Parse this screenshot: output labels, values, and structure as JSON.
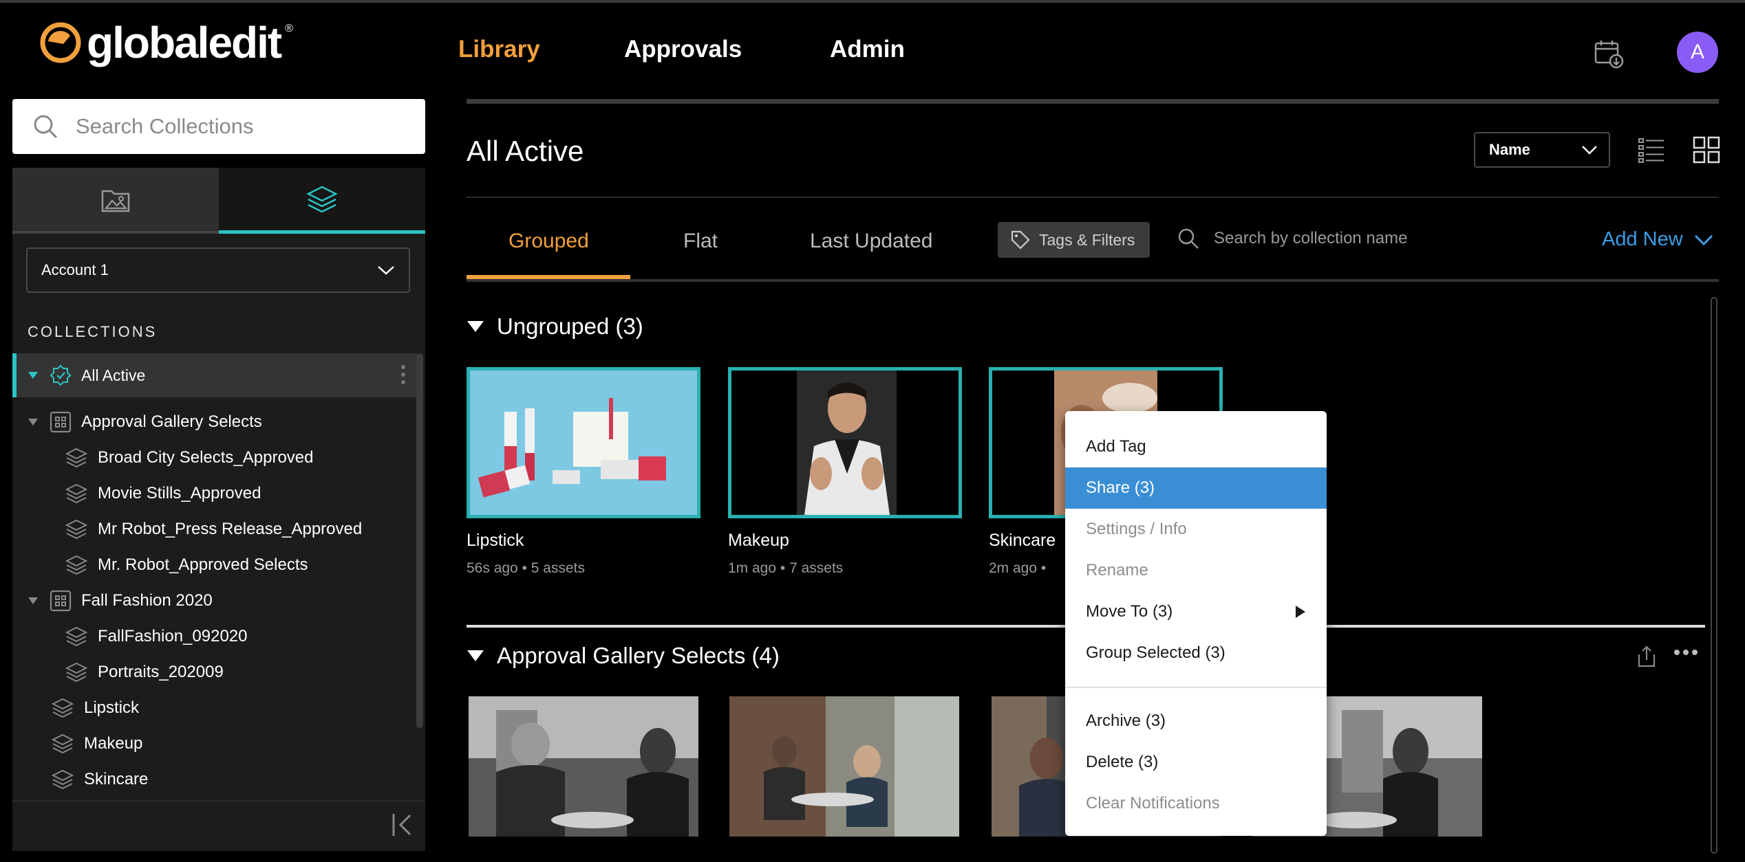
{
  "app": {
    "logo_text": "globaledit",
    "logo_mark": "®"
  },
  "nav": {
    "library": "Library",
    "approvals": "Approvals",
    "admin": "Admin",
    "avatar_initial": "A",
    "active_color": "#f2a03d"
  },
  "sidebar": {
    "search_placeholder": "Search Collections",
    "account": "Account 1",
    "collections_heading": "COLLECTIONS",
    "all_active": "All Active",
    "accent_color": "#2cc4c4",
    "tree": [
      {
        "label": "Approval Gallery Selects",
        "type": "group",
        "expanded": true
      },
      {
        "label": "Broad City Selects_Approved",
        "type": "collection"
      },
      {
        "label": "Movie Stills_Approved",
        "type": "collection"
      },
      {
        "label": "Mr Robot_Press Release_Approved",
        "type": "collection"
      },
      {
        "label": "Mr. Robot_Approved Selects",
        "type": "collection"
      },
      {
        "label": "Fall Fashion 2020",
        "type": "group",
        "expanded": true
      },
      {
        "label": "FallFashion_092020",
        "type": "collection"
      },
      {
        "label": "Portraits_202009",
        "type": "collection"
      },
      {
        "label": "Lipstick",
        "type": "collection"
      },
      {
        "label": "Makeup",
        "type": "collection"
      },
      {
        "label": "Skincare",
        "type": "collection"
      }
    ]
  },
  "main": {
    "title": "All Active",
    "sort_label": "Name",
    "tabs": {
      "grouped": "Grouped",
      "flat": "Flat",
      "last_updated": "Last Updated"
    },
    "tags_filters": "Tags & Filters",
    "search_placeholder": "Search by collection name",
    "add_new": "Add New",
    "link_color": "#3b9ee8",
    "groups": {
      "ungrouped": "Ungrouped (3)",
      "approval": "Approval Gallery Selects (4)"
    },
    "cards": [
      {
        "title": "Lipstick",
        "time": "56s ago",
        "assets": "5 assets"
      },
      {
        "title": "Makeup",
        "time": "1m ago",
        "assets": "7 assets"
      },
      {
        "title": "Skincare",
        "time": "2m ago",
        "assets": ""
      }
    ],
    "selection_color": "#2ab0b0"
  },
  "context_menu": {
    "items": [
      {
        "label": "Add Tag",
        "state": "normal"
      },
      {
        "label": "Share (3)",
        "state": "active"
      },
      {
        "label": "Settings / Info",
        "state": "disabled"
      },
      {
        "label": "Rename",
        "state": "disabled"
      },
      {
        "label": "Move To (3)",
        "state": "normal",
        "submenu": true
      },
      {
        "label": "Group Selected (3)",
        "state": "normal"
      },
      {
        "label": "Archive (3)",
        "state": "normal"
      },
      {
        "label": "Delete (3)",
        "state": "normal"
      },
      {
        "label": "Clear Notifications",
        "state": "disabled"
      }
    ],
    "highlight_color": "#3a8fd4"
  },
  "icons": {
    "logo": "globaledit-logo-icon",
    "download": "download-calendar-icon",
    "search": "search-icon",
    "gallery_tab": "image-folder-icon",
    "collections_tab": "layers-icon",
    "chevron": "chevron-down-icon",
    "all_active": "gear-badge-icon",
    "group": "grid-group-icon",
    "collection": "layers-icon",
    "collapse": "collapse-left-icon",
    "list_view": "list-view-icon",
    "grid_view": "grid-view-icon",
    "tag": "tag-icon",
    "share": "share-icon",
    "more": "more-horizontal-icon",
    "caret": "caret-down-icon",
    "submenu": "caret-right-icon"
  }
}
